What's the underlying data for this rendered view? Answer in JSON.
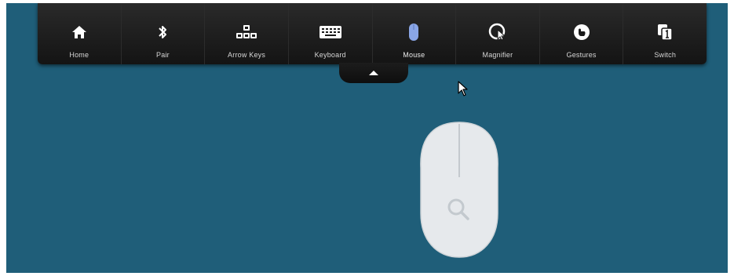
{
  "toolbar": {
    "items": [
      {
        "label": "Home",
        "icon": "home-icon"
      },
      {
        "label": "Pair",
        "icon": "bluetooth-icon"
      },
      {
        "label": "Arrow Keys",
        "icon": "arrow-keys-icon"
      },
      {
        "label": "Keyboard",
        "icon": "keyboard-icon"
      },
      {
        "label": "Mouse",
        "icon": "mouse-icon",
        "active": true
      },
      {
        "label": "Magnifier",
        "icon": "magnifier-icon"
      },
      {
        "label": "Gestures",
        "icon": "gestures-icon"
      },
      {
        "label": "Switch",
        "icon": "switch-icon"
      }
    ],
    "toggle_icon": "chevron-up-icon"
  },
  "colors": {
    "background": "#1f5e79",
    "toolbar": "#1a1a1a",
    "active_icon": "#8aa6e6",
    "icon": "#ffffff",
    "label": "#d6d6d6"
  },
  "cursor_icon": "arrow-cursor-icon",
  "mouse_device_icon": "search-icon"
}
